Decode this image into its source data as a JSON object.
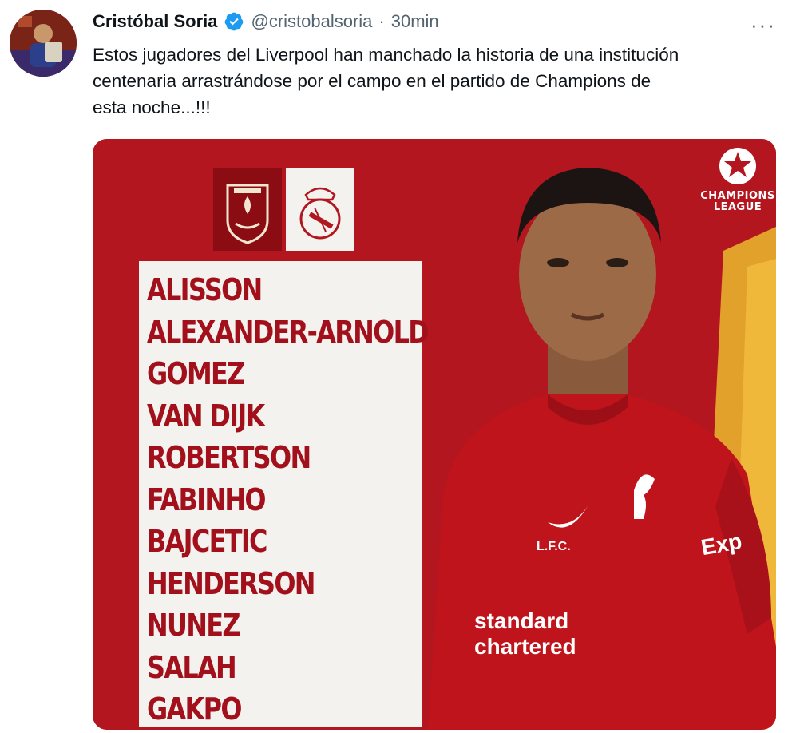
{
  "tweet": {
    "author_name": "Cristóbal Soria",
    "handle": "@cristobalsoria",
    "separator": "·",
    "time": "30min",
    "more_label": "···",
    "text_lines": [
      "Estos jugadores del Liverpool han manchado la historia de una institución",
      "centenaria arrastrándose por el campo en el partido de Champions de",
      "esta noche...!!!"
    ]
  },
  "media": {
    "lineup": [
      "ALISSON",
      "ALEXANDER-ARNOLD",
      "GOMEZ",
      "VAN DIJK",
      "ROBERTSON",
      "FABINHO",
      "BAJCETIC",
      "HENDERSON",
      "NUNEZ",
      "SALAH",
      "GAKPO"
    ],
    "competition_logo_lines": [
      "CHAMPIONS",
      "LEAGUE"
    ],
    "shirt_badge": "L.F.C.",
    "sponsor_lines": [
      "standard",
      "chartered"
    ],
    "sleeve_text": "Exp"
  },
  "colors": {
    "verified": "#1d9bf0",
    "liverpool_red": "#b0171f",
    "text_muted": "#536471"
  }
}
